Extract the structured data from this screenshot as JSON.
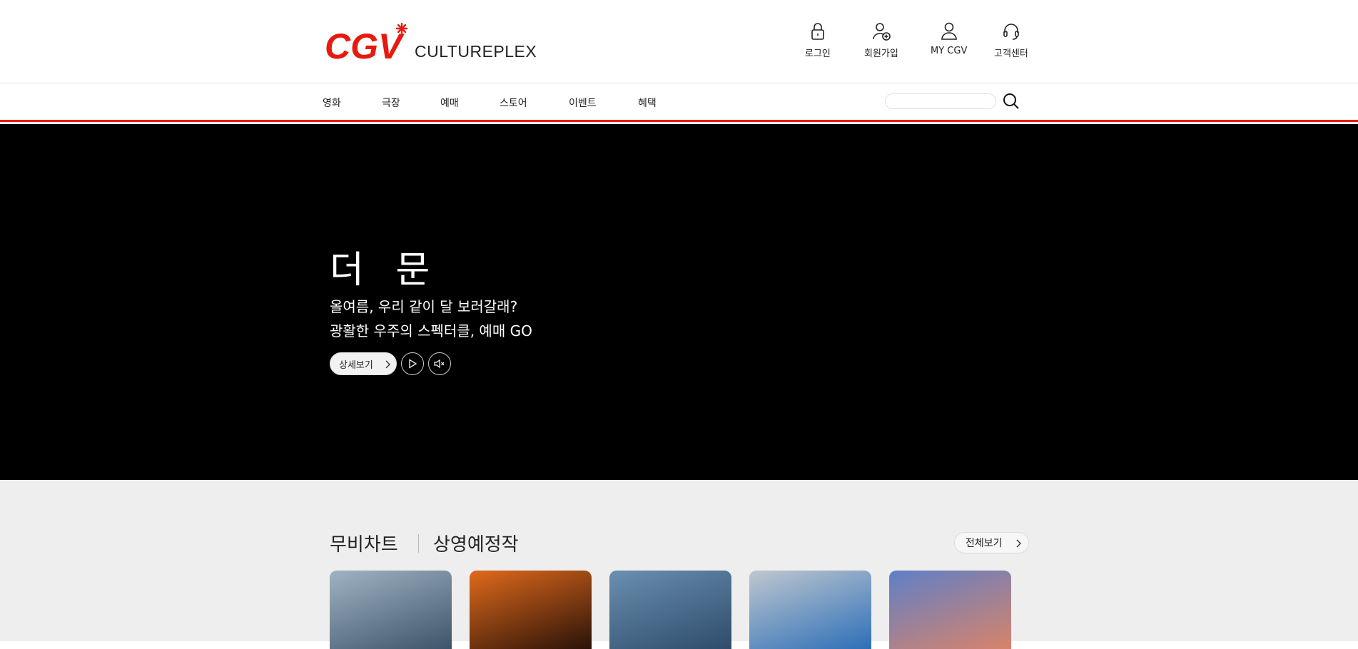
{
  "brand": {
    "logo_text": "CGV",
    "tagline": "CULTUREPLEX",
    "accent_color": "#e71a0f"
  },
  "utility": [
    {
      "label": "로그인",
      "icon": "lock-icon"
    },
    {
      "label": "회원가입",
      "icon": "user-add-icon"
    },
    {
      "label": "MY CGV",
      "icon": "user-icon"
    },
    {
      "label": "고객센터",
      "icon": "headset-icon"
    }
  ],
  "nav": {
    "items": [
      "영화",
      "극장",
      "예매",
      "스토어",
      "이벤트",
      "혜택"
    ],
    "search_placeholder": ""
  },
  "hero": {
    "title": "더 문",
    "line1": "올여름, 우리 같이 달 보러갈래?",
    "line2": "광활한 우주의 스펙터클, 예매 GO",
    "detail_label": "상세보기"
  },
  "movie_section": {
    "tab_active": "무비차트",
    "tab_inactive": "상영예정작",
    "all_label": "전체보기",
    "posters": [
      {
        "name": "poster-the-moon",
        "colors": [
          "#9fb3c4",
          "#3e5468"
        ]
      },
      {
        "name": "poster-oppenheimer",
        "colors": [
          "#e06a1c",
          "#2a1208"
        ]
      },
      {
        "name": "poster-concrete-utopia",
        "colors": [
          "#6a8fb0",
          "#2e4c6b"
        ]
      },
      {
        "name": "poster-smugglers",
        "colors": [
          "#bfc7cf",
          "#2d6fb8"
        ]
      },
      {
        "name": "poster-elemental",
        "colors": [
          "#5f7fc7",
          "#d8836a"
        ]
      }
    ]
  }
}
